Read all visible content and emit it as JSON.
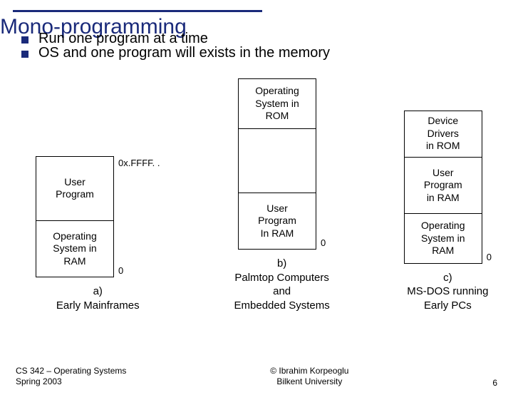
{
  "title": "Mono-programming",
  "bullets": [
    "Run one program at a time",
    "OS and one program will exists in the memory"
  ],
  "colA": {
    "topAddr": "0x.FFFF. .",
    "cells": [
      "User\nProgram",
      "Operating\nSystem in\nRAM"
    ],
    "bottomAddr": "0",
    "caption": "a)\nEarly Mainframes"
  },
  "colB": {
    "cells": [
      "Operating\nSystem in\nROM",
      "",
      "User\nProgram\nIn RAM"
    ],
    "bottomAddr": "0",
    "caption": "b)\nPalmtop Computers\nand\nEmbedded Systems"
  },
  "colC": {
    "cells": [
      "Device\nDrivers\nin ROM",
      "User\nProgram\nin RAM",
      "Operating\nSystem in\nRAM"
    ],
    "bottomAddr": "0",
    "caption": "c)\nMS-DOS running\nEarly PCs"
  },
  "footer": {
    "left": "CS 342 – Operating Systems\nSpring 2003",
    "center": "© Ibrahim Korpeoglu\nBilkent University",
    "right": "6"
  }
}
